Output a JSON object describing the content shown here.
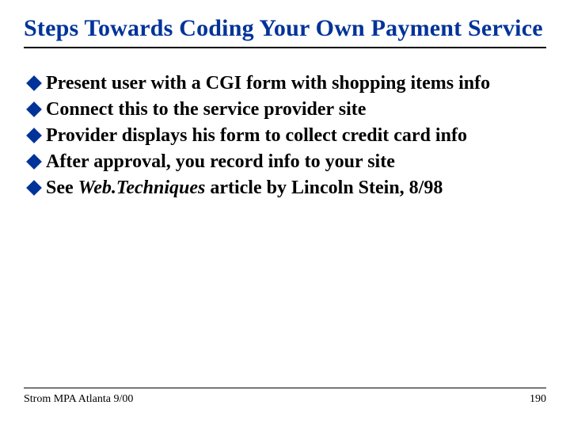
{
  "title": "Steps Towards Coding Your Own Payment Service",
  "bullets": [
    {
      "before": "Present user with a CGI form with shopping items info",
      "italic": "",
      "after": ""
    },
    {
      "before": "Connect this to the service provider site",
      "italic": "",
      "after": ""
    },
    {
      "before": "Provider displays his form to collect credit card info",
      "italic": "",
      "after": ""
    },
    {
      "before": "After approval, you record info to your site",
      "italic": "",
      "after": ""
    },
    {
      "before": "See ",
      "italic": "Web.Techniques",
      "after": " article by Lincoln Stein, 8/98"
    }
  ],
  "footer": {
    "left": "Strom MPA Atlanta 9/00",
    "right": "190"
  }
}
